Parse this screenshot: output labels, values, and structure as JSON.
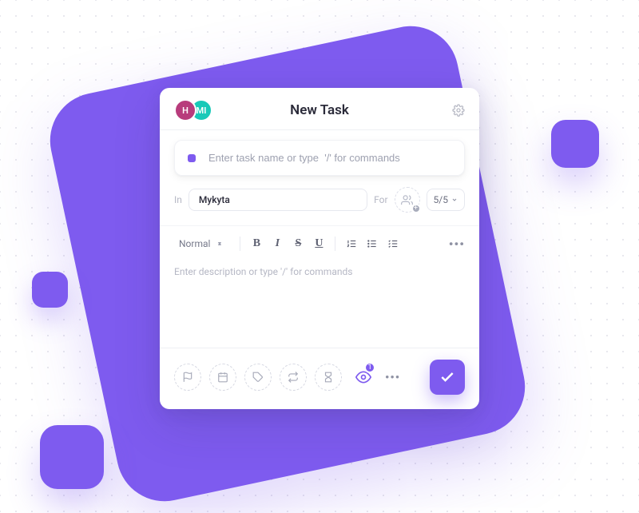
{
  "header": {
    "title": "New Task",
    "avatars": [
      {
        "initial": "H",
        "color": "#b83c7c"
      },
      {
        "initial": "MI",
        "color": "#18c9b8"
      }
    ]
  },
  "task_name": {
    "placeholder": "Enter task name or type  '/' for commands",
    "value": ""
  },
  "meta": {
    "in_label": "In",
    "location": "Mykyta",
    "for_label": "For",
    "progress": "5/5"
  },
  "editor": {
    "format_label": "Normal"
  },
  "description": {
    "placeholder": "Enter description or type '/' for commands",
    "value": ""
  },
  "footer": {
    "watchers_count": "1"
  }
}
